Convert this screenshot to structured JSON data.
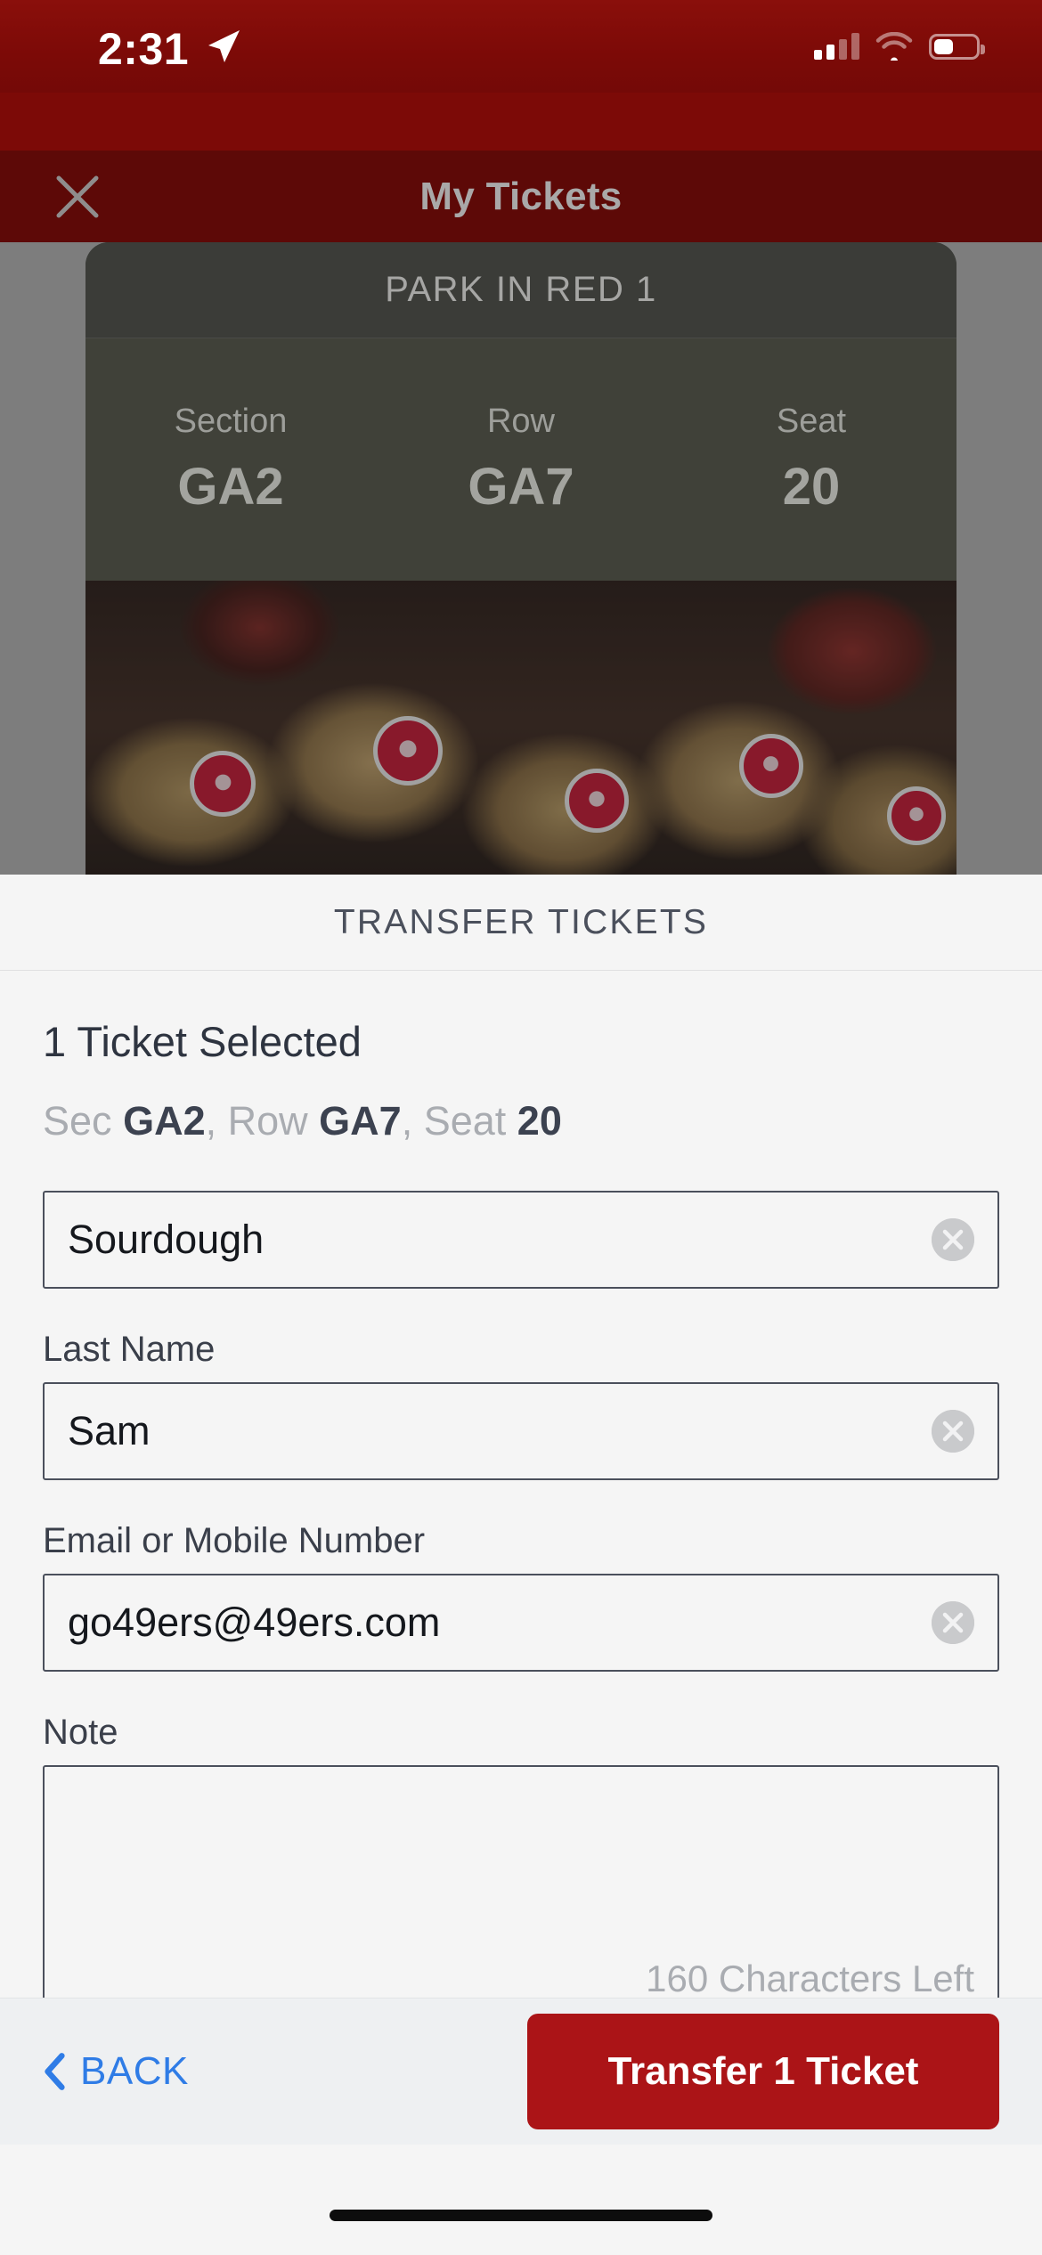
{
  "statusbar": {
    "time": "2:31",
    "location_icon": "location-arrow-icon",
    "cellular_icon": "cellular-bars-icon",
    "wifi_icon": "wifi-icon",
    "battery_icon": "battery-icon"
  },
  "navbar": {
    "close_icon": "close-icon",
    "title": "My Tickets"
  },
  "ticket_card": {
    "banner": "PARK IN RED 1",
    "columns": [
      {
        "label": "Section",
        "value": "GA2"
      },
      {
        "label": "Row",
        "value": "GA7"
      },
      {
        "label": "Seat",
        "value": "20"
      }
    ],
    "photo_alt": "49ers helmets"
  },
  "sheet": {
    "header_title": "TRANSFER TICKETS",
    "selection_title": "1 Ticket Selected",
    "selection_detail": {
      "sec_label": "Sec",
      "sec_value": "GA2",
      "row_label": "Row",
      "row_value": "GA7",
      "seat_label": "Seat",
      "seat_value": "20",
      "separator": ", "
    },
    "fields": [
      {
        "label": "",
        "value": "Sourdough",
        "placeholder": "First Name",
        "clear_icon": "clear-circle-icon"
      },
      {
        "label": "Last Name",
        "value": "Sam",
        "placeholder": "Last Name",
        "clear_icon": "clear-circle-icon"
      },
      {
        "label": "Email or Mobile Number",
        "value": "go49ers@49ers.com",
        "placeholder": "Email or Mobile Number",
        "clear_icon": "clear-circle-icon"
      }
    ],
    "note": {
      "label": "Note",
      "value": "",
      "placeholder": "",
      "characters_left": "160 Characters Left"
    }
  },
  "footer": {
    "back_icon": "chevron-left-icon",
    "back_label": "BACK",
    "transfer_label": "Transfer 1 Ticket"
  },
  "colors": {
    "status_red": "#7c0a07",
    "navbar_red": "#5d0907",
    "transfer_red": "#ab1417",
    "link_blue": "#2f7ce6",
    "sheet_bg": "#f5f5f5",
    "footer_bg": "#eef0f2",
    "text_dark": "#2e3440",
    "text_muted": "#a9acb1",
    "border_dark": "#4b505c"
  }
}
